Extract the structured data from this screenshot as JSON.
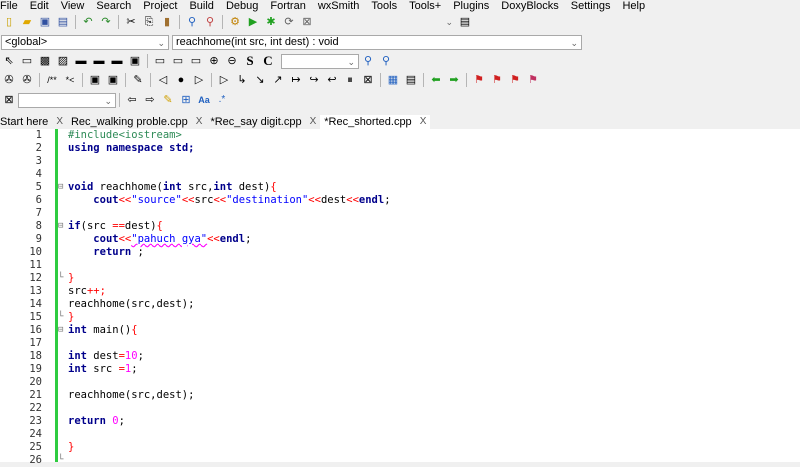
{
  "menu": [
    "File",
    "Edit",
    "View",
    "Search",
    "Project",
    "Build",
    "Debug",
    "Fortran",
    "wxSmith",
    "Tools",
    "Tools+",
    "Plugins",
    "DoxyBlocks",
    "Settings",
    "Help"
  ],
  "scope": {
    "value": "<global>",
    "function": "reachhome(int src, int dest) : void"
  },
  "search_combo": {
    "value": ""
  },
  "symbol_buttons": {
    "s": "S",
    "c": "C"
  },
  "regex_label": ".*",
  "aa_label": "Aa",
  "tabs": [
    {
      "label": "Start here"
    },
    {
      "label": "Rec_walking proble.cpp"
    },
    {
      "label": "*Rec_say digit.cpp"
    },
    {
      "label": "*Rec_shorted.cpp"
    }
  ],
  "code": {
    "line_numbers": [
      "1",
      "2",
      "3",
      "4",
      "5",
      "6",
      "7",
      "8",
      "9",
      "10",
      "11",
      "12",
      "13",
      "14",
      "15",
      "16",
      "17",
      "18",
      "19",
      "20",
      "21",
      "22",
      "23",
      "24",
      "25",
      "26"
    ],
    "l1": "#include<iostream>",
    "l2_kw1": "using",
    "l2_kw2": "namespace",
    "l2_id": "std;",
    "l5_kw": "void",
    "l5_name": " reachhome(",
    "l5_kw2": "int",
    "l5_a": " src,",
    "l5_kw3": "int",
    "l5_b": " dest)",
    "l6_a": "cout",
    "l6_s1": "\"source\"",
    "l6_b": "src",
    "l6_s2": "\"destination\"",
    "l6_c": "dest",
    "l6_d": "endl",
    "l8_kw": "if",
    "l8_a": "(src ",
    "l8_op": "==",
    "l8_b": "dest)",
    "l9_a": "cout",
    "l9_s": "\"pahuch gya\"",
    "l9_d": "endl",
    "l10_kw": "return",
    "l10_a": " ;",
    "l13_a": "src",
    "l13_op": "++;",
    "l14": "reachhome(src,dest);",
    "l16_kw": "int",
    "l16_a": " main()",
    "l18_kw": "int",
    "l18_a": " dest",
    "l18_n": "10",
    "l19_kw": "int",
    "l19_a": " src ",
    "l19_n": "1",
    "l21": "reachhome(src,dest);",
    "l23_kw": "return",
    "l23_n": "0"
  }
}
